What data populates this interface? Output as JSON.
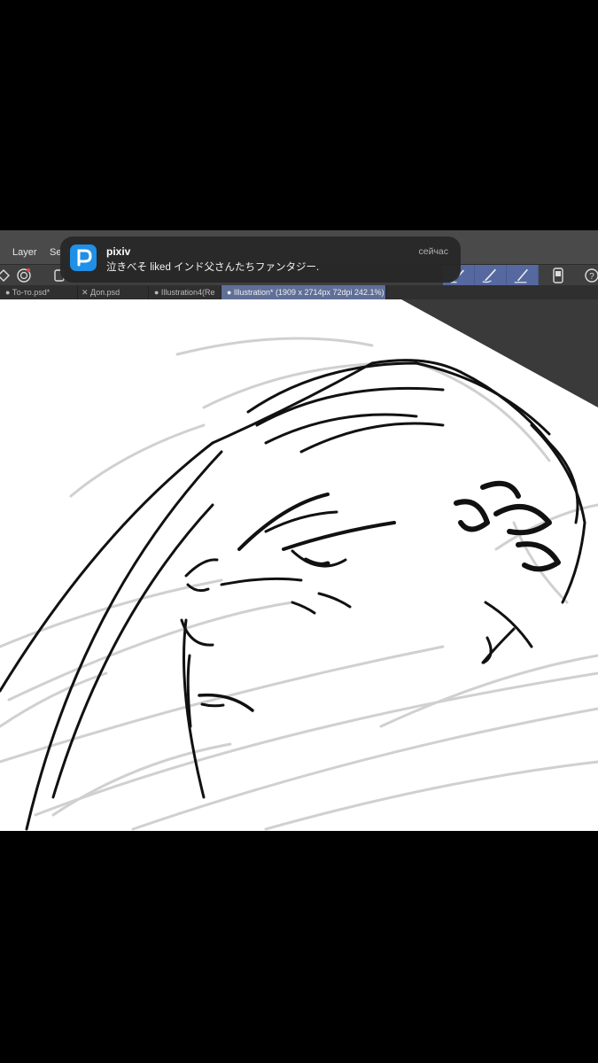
{
  "menubar": {
    "items": [
      "Layer",
      "Se"
    ]
  },
  "tabs": [
    {
      "label": "● То-то.psd*",
      "active": false
    },
    {
      "label": "✕ Доп.psd",
      "active": false
    },
    {
      "label": "● Illustration4(Re",
      "active": false
    },
    {
      "label": "● Illustration* (1909 x 2714px 72dpi 242.1%)",
      "active": true
    }
  ],
  "notification": {
    "app": "pixiv",
    "message": "泣きべそ liked インド父さんたちファンタジー.",
    "time": "сейчас",
    "icon": "pixiv-logo-icon",
    "icon_color": "#1f8fe8"
  },
  "toolbar": {
    "icons": [
      "transform-icon",
      "lasso-icon",
      "selection-icon",
      "pen-brush-icon",
      "brush-icon",
      "pencil-brush-icon",
      "phone-icon",
      "help-icon"
    ],
    "accent": "#5568a0"
  },
  "canvas": {
    "paper_color": "#ffffff",
    "background_color": "#3a3a3a"
  }
}
